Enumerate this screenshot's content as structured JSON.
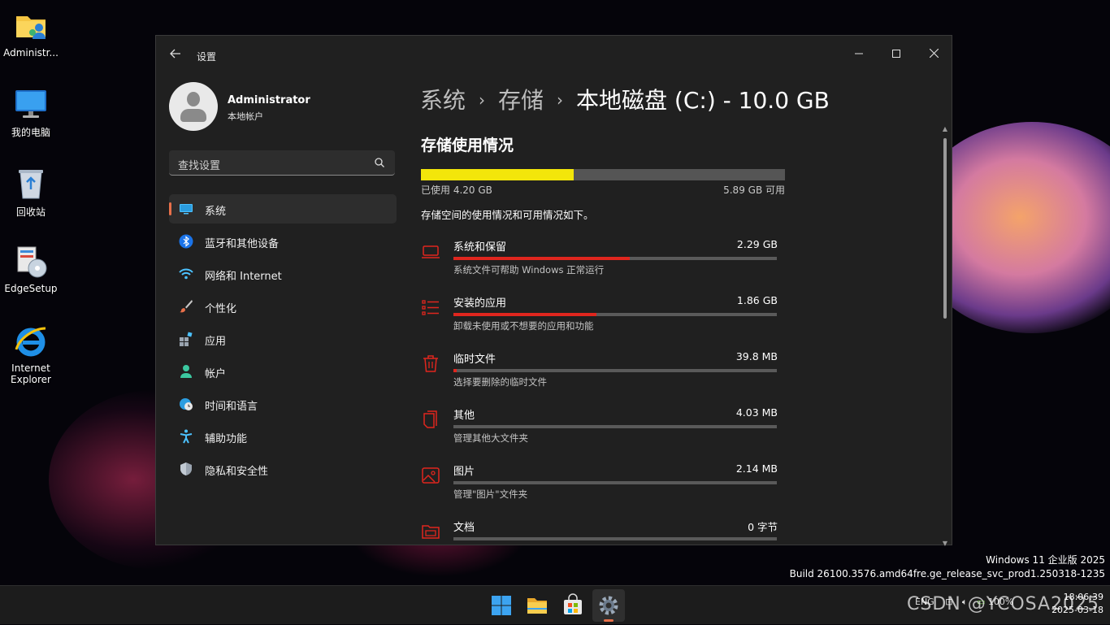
{
  "desktop": {
    "icons": [
      {
        "label": "Administr...",
        "icon": "user-folder-icon"
      },
      {
        "label": "我的电脑",
        "icon": "computer-icon"
      },
      {
        "label": "回收站",
        "icon": "recycle-bin-icon"
      },
      {
        "label": "EdgeSetup",
        "icon": "setup-installer-icon"
      },
      {
        "label": "Internet Explorer",
        "icon": "internet-explorer-icon"
      }
    ]
  },
  "window": {
    "app_title": "设置",
    "controls": {
      "minimize": "—",
      "maximize": "☐",
      "close": "✕"
    }
  },
  "account": {
    "name": "Administrator",
    "type": "本地帐户"
  },
  "search": {
    "placeholder": "查找设置"
  },
  "nav": [
    {
      "label": "系统",
      "icon": "monitor-icon",
      "active": true
    },
    {
      "label": "蓝牙和其他设备",
      "icon": "bluetooth-icon"
    },
    {
      "label": "网络和 Internet",
      "icon": "wifi-icon"
    },
    {
      "label": "个性化",
      "icon": "paintbrush-icon"
    },
    {
      "label": "应用",
      "icon": "apps-icon"
    },
    {
      "label": "帐户",
      "icon": "person-icon"
    },
    {
      "label": "时间和语言",
      "icon": "globe-clock-icon"
    },
    {
      "label": "辅助功能",
      "icon": "accessibility-icon"
    },
    {
      "label": "隐私和安全性",
      "icon": "shield-icon"
    }
  ],
  "breadcrumb": {
    "level1": "系统",
    "level2": "存储",
    "current": "本地磁盘 (C:) - 10.0 GB",
    "separator": "›"
  },
  "storage": {
    "section_title": "存储使用情况",
    "used_label": "已使用 4.20 GB",
    "free_label": "5.89 GB 可用",
    "used_fraction": 0.42,
    "description": "存储空间的使用情况和可用情况如下。",
    "categories": [
      {
        "name": "系统和保留",
        "size": "2.29 GB",
        "sub": "系统文件可帮助 Windows 正常运行",
        "fraction": 0.545,
        "icon": "laptop-icon"
      },
      {
        "name": "安装的应用",
        "size": "1.86 GB",
        "sub": "卸载未使用或不想要的应用和功能",
        "fraction": 0.443,
        "icon": "app-list-icon"
      },
      {
        "name": "临时文件",
        "size": "39.8 MB",
        "sub": "选择要删除的临时文件",
        "fraction": 0.01,
        "icon": "trash-icon"
      },
      {
        "name": "其他",
        "size": "4.03 MB",
        "sub": "管理其他大文件夹",
        "fraction": 0.0,
        "icon": "file-copy-icon"
      },
      {
        "name": "图片",
        "size": "2.14 MB",
        "sub": "管理\"图片\"文件夹",
        "fraction": 0.0,
        "icon": "image-icon"
      },
      {
        "name": "文档",
        "size": "0 字节",
        "sub": "",
        "fraction": 0.0,
        "icon": "folder-icon"
      }
    ]
  },
  "watermark": {
    "line1": "Windows 11 企业版 2025",
    "line2": "Build 26100.3576.amd64fre.ge_release_svc_prod1.250318-1235"
  },
  "taskbar": {
    "apps": [
      {
        "name": "start",
        "icon": "windows-logo-icon"
      },
      {
        "name": "file-explorer",
        "icon": "folder-icon"
      },
      {
        "name": "store",
        "icon": "store-icon"
      },
      {
        "name": "settings",
        "icon": "gear-icon",
        "active": true
      }
    ],
    "tray": {
      "lang": "ENG",
      "battery": "100%"
    },
    "clock": {
      "time": "18:06:39",
      "date": "2025-03-18"
    },
    "overlay_text": "CSDN @YCOSA2025"
  },
  "colors": {
    "accent": "#e8704a",
    "used_bar": "#f3e60a",
    "category_bar": "#e0261e",
    "window_bg": "#202020"
  }
}
